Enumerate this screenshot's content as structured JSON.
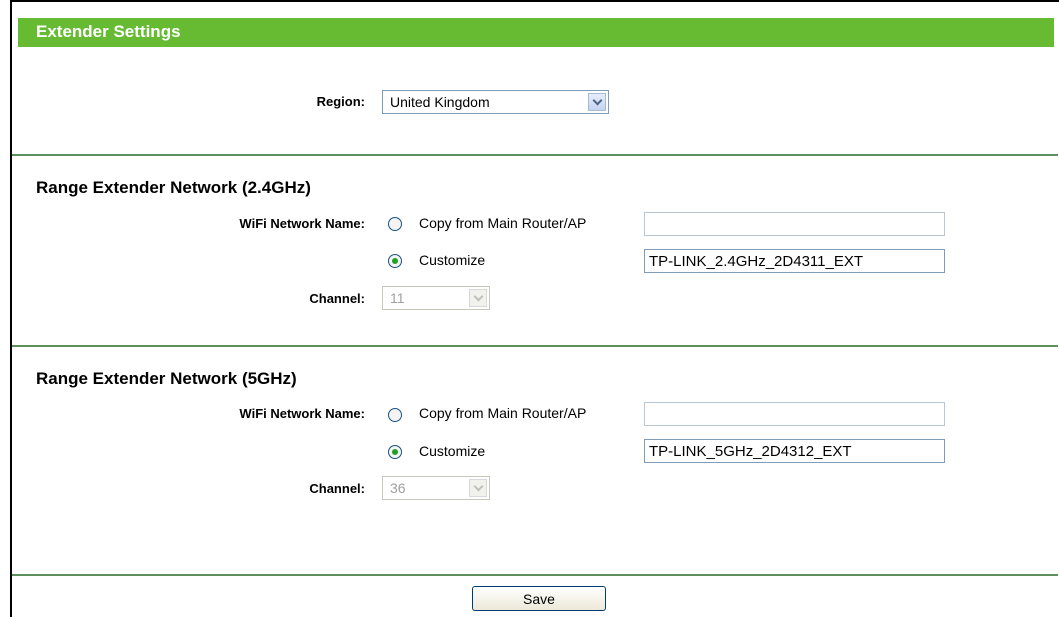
{
  "header": {
    "title": "Extender Settings"
  },
  "region": {
    "label": "Region:",
    "selected": "United Kingdom"
  },
  "net24": {
    "title": "Range Extender Network (2.4GHz)",
    "name_label": "WiFi Network Name:",
    "copy_label": "Copy from Main Router/AP",
    "copy_value": "",
    "customize_label": "Customize",
    "customize_value": "TP-LINK_2.4GHz_2D4311_EXT",
    "channel_label": "Channel:",
    "channel_value": "11",
    "selected_option": "Customize"
  },
  "net5": {
    "title": "Range Extender Network (5GHz)",
    "name_label": "WiFi Network Name:",
    "copy_label": "Copy from Main Router/AP",
    "copy_value": "",
    "customize_label": "Customize",
    "customize_value": "TP-LINK_5GHz_2D4312_EXT",
    "channel_label": "Channel:",
    "channel_value": "36",
    "selected_option": "Customize"
  },
  "actions": {
    "save_label": "Save"
  },
  "colors": {
    "header_bg": "#66bb33",
    "divider": "#5b8f5b",
    "radio_dot": "#21a121"
  }
}
